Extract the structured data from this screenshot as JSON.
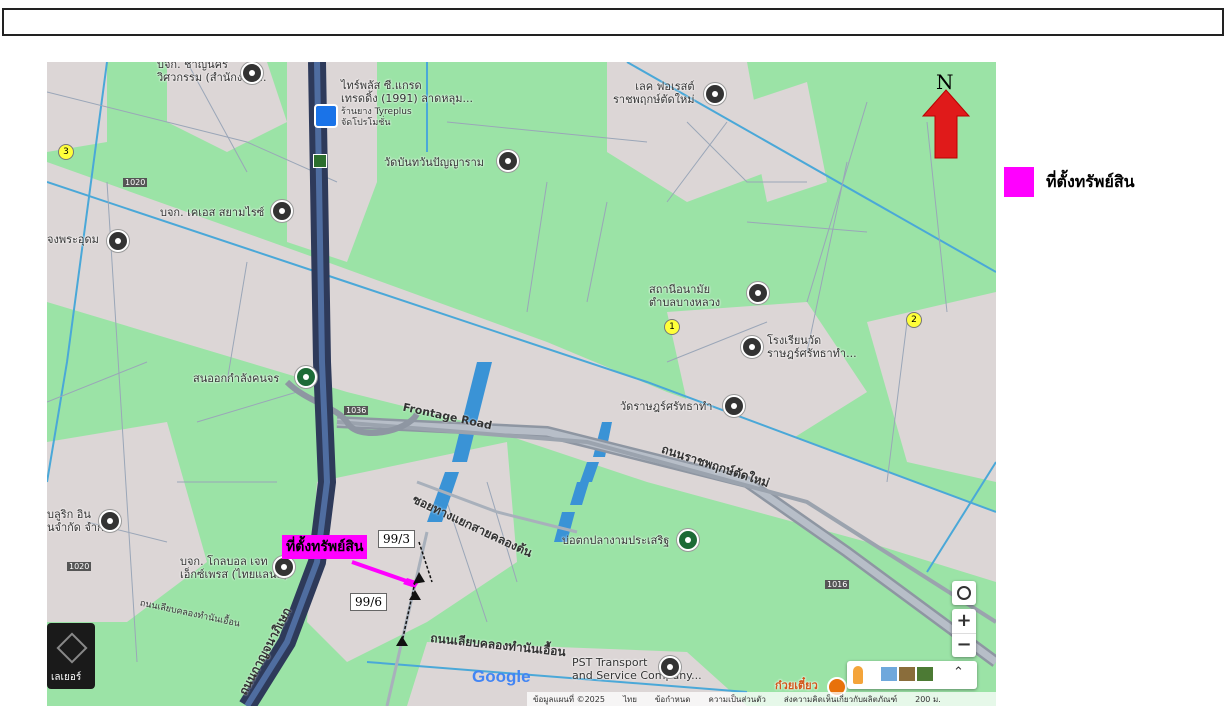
{
  "map": {
    "places": {
      "p1": "บจก. ชาญนคร\nวิศวกรรม (สำนักงาน...",
      "p2": "ไทร์พลัส ซี.แกรด\nเทรดดิ้ง (1991) ลาดหลุม...",
      "p2sub": "ร้านยาง Tyreplus\nจัดโปรโมชั่น",
      "p3": "เลค ฟอเรสต์\nราชพฤกษ์ตัดใหม่",
      "p4": "วัดบันทวันปัญญาราม",
      "p5": "บจก. เคเอส สยามไรซ์",
      "p6": "จงพระอุดม",
      "p7": "สถานีอนามัย\nตำบลบางหลวง",
      "p8": "โรงเรียนวัด\nราษฎร์ศรัทธาทำ...",
      "p9": "สนามกีฬาจังหวัด",
      "p9b": "สนออกกำลังคนจร",
      "p10": "วัดราษฎร์ศรัทธาทำ",
      "p11": "บลูริก อิน\nนจำกัด จำกัด",
      "p12": "บจก. โกลบอล เจท\nเอ็กซ์เพรส (ไทยแลนด์)",
      "p13": "บ่อตกปลางามประเสริฐ",
      "p14": "PST Transport\nand Service Company...",
      "p15": "ก๋วยเตี๋ยว"
    },
    "roads": {
      "frontage": "Frontage Road",
      "ratchaphruek": "ถนนราชพฤกษ์ตัดใหม่",
      "soi": "ซอยทางแยกสายคลองต้น",
      "khlong": "ถนนเลียบคลองทำนันเอื้อน",
      "khlong2": "ถนนเลียบคลองทำนันเอื้อน",
      "kanchana": "ถนนกาญจนาภิเษก",
      "r1036": "1036",
      "r1020": "1020",
      "r1020b": "1020",
      "r1016": "1016"
    },
    "numbers": [
      "1",
      "2",
      "3"
    ],
    "marker_label": "ที่ตั้งทรัพย์สิน",
    "lots": [
      "99/3",
      "99/6"
    ],
    "north": "N",
    "google": "Google",
    "layers_label": "เลเยอร์",
    "footer": [
      "ข้อมูลแผนที่ ©2025",
      "ไทย",
      "ข้อกำหนด",
      "ความเป็นส่วนตัว",
      "ส่งความคิดเห็นเกี่ยวกับผลิตภัณฑ์",
      "200 ม."
    ]
  },
  "legend": {
    "label": "ที่ตั้งทรัพย์สิน",
    "color": "#ff00ff"
  }
}
